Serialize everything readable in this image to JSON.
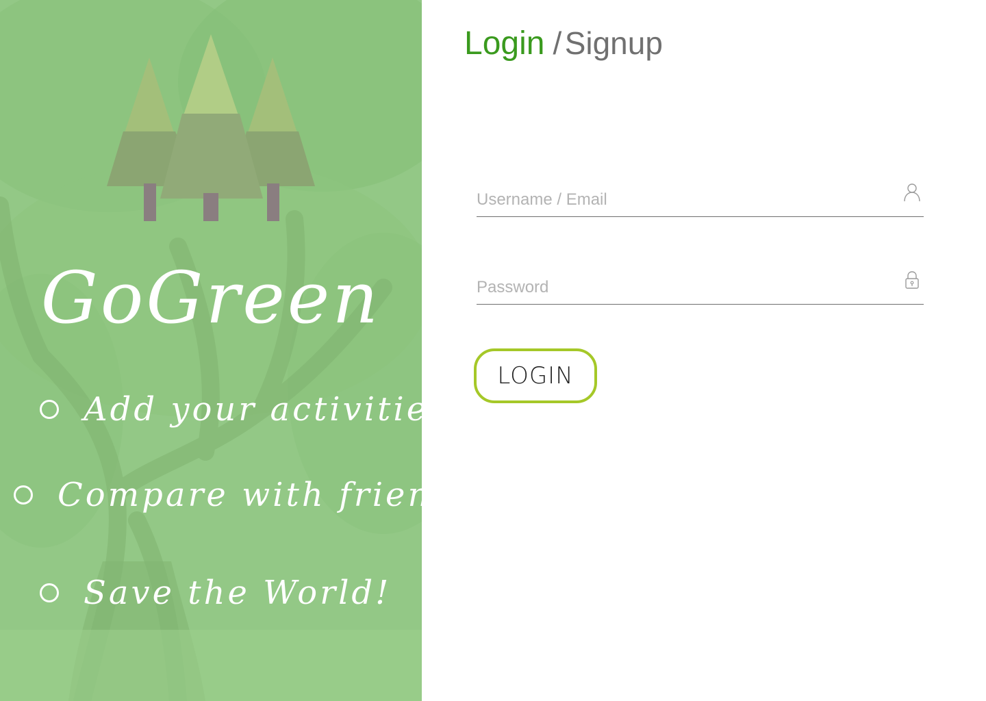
{
  "brand": {
    "name": "GoGreen",
    "features": [
      "Add your activities",
      "Compare with friends",
      "Save the World!"
    ]
  },
  "auth": {
    "login_tab": "Login",
    "separator": "/",
    "signup_tab": "Signup",
    "username_placeholder": "Username / Email",
    "password_placeholder": "Password",
    "login_button": "LOGIN"
  },
  "icons": {
    "username": "user-icon",
    "password": "lock-icon",
    "logo": "pine-trees-logo"
  },
  "colors": {
    "accent_green": "#3a9a1e",
    "button_border": "#a5c828",
    "panel_green": "#92c784"
  }
}
